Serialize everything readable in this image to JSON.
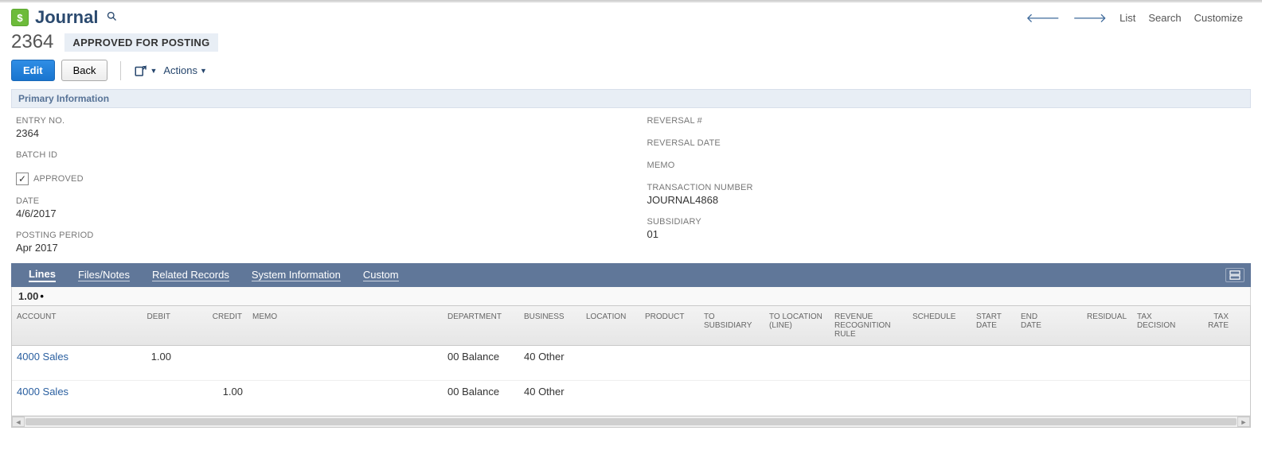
{
  "page": {
    "title": "Journal"
  },
  "header_links": {
    "list": "List",
    "search": "Search",
    "customize": "Customize"
  },
  "record": {
    "entry_no_display": "2364",
    "status": "APPROVED FOR POSTING"
  },
  "buttons": {
    "edit": "Edit",
    "back": "Back",
    "actions": "Actions"
  },
  "section": {
    "primary_info": "Primary Information"
  },
  "fields": {
    "entry_no_label": "ENTRY NO.",
    "entry_no_value": "2364",
    "batch_id_label": "BATCH ID",
    "batch_id_value": "",
    "approved_label": "APPROVED",
    "approved_checked": "✓",
    "date_label": "DATE",
    "date_value": "4/6/2017",
    "posting_period_label": "POSTING PERIOD",
    "posting_period_value": "Apr 2017",
    "reversal_no_label": "REVERSAL #",
    "reversal_no_value": "",
    "reversal_date_label": "REVERSAL DATE",
    "reversal_date_value": "",
    "memo_label": "MEMO",
    "memo_value": "",
    "transaction_number_label": "TRANSACTION NUMBER",
    "transaction_number_value": "JOURNAL4868",
    "subsidiary_label": "SUBSIDIARY",
    "subsidiary_value": "01"
  },
  "tabs": {
    "lines": "Lines",
    "files_notes": "Files/Notes",
    "related_records": "Related Records",
    "system_information": "System Information",
    "custom": "Custom"
  },
  "lines_total": "1.00",
  "grid": {
    "headers": {
      "account": "ACCOUNT",
      "debit": "DEBIT",
      "credit": "CREDIT",
      "memo": "MEMO",
      "department": "DEPARTMENT",
      "business": "BUSINESS",
      "location": "LOCATION",
      "product": "PRODUCT",
      "to_subsidiary": "TO SUBSIDIARY",
      "to_location_line": "TO LOCATION (LINE)",
      "revenue_recognition_rule": "REVENUE RECOGNITION RULE",
      "schedule": "SCHEDULE",
      "start_date": "START DATE",
      "end_date": "END DATE",
      "residual": "RESIDUAL",
      "tax_decision": "TAX DECISION",
      "tax_rate": "TAX RATE"
    },
    "rows": [
      {
        "account": "4000 Sales",
        "debit": "1.00",
        "credit": "",
        "memo": "",
        "department": "00 Balance",
        "business": "40 Other"
      },
      {
        "account": "4000 Sales",
        "debit": "",
        "credit": "1.00",
        "memo": "",
        "department": "00 Balance",
        "business": "40 Other"
      }
    ]
  }
}
